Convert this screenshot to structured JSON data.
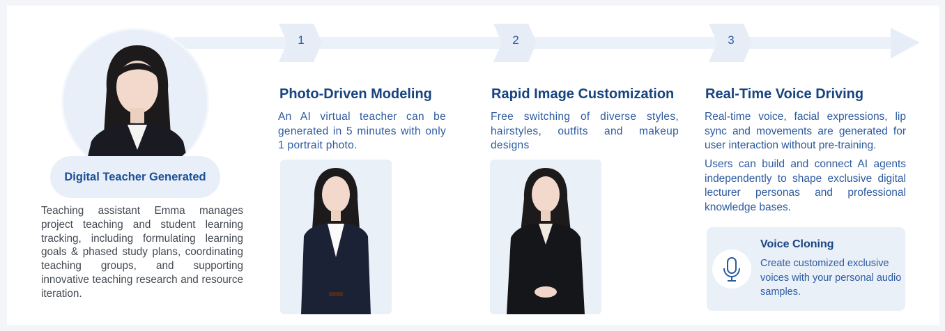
{
  "profile": {
    "badge": "Digital Teacher Generated",
    "description": "Teaching assistant Emma manages project teaching and student learning tracking, including formulating learning goals & phased study plans, coordinating teaching groups, and supporting innovative teaching research and resource iteration."
  },
  "steps": [
    {
      "number": "1",
      "title": "Photo-Driven Modeling",
      "text": "An AI virtual teacher can be generated in 5 minutes with only 1 portrait photo."
    },
    {
      "number": "2",
      "title": "Rapid Image Customization",
      "text": "Free switching of diverse styles, hairstyles, outfits and makeup designs"
    },
    {
      "number": "3",
      "title": "Real-Time Voice Driving",
      "text": "Real-time voice, facial expressions, lip sync and movements are generated for user interaction without pre-training.",
      "text2": "Users can build and connect AI agents independently to shape exclusive digital lecturer personas and professional knowledge bases."
    }
  ],
  "voice_card": {
    "title": "Voice Cloning",
    "description": "Create customized exclusive voices with your personal audio samples.",
    "icon": "microphone-icon"
  },
  "colors": {
    "accent": "#17437f",
    "text_blue": "#2c5aa0",
    "panel": "#eaf0f8",
    "arrow": "#e8eef7"
  }
}
